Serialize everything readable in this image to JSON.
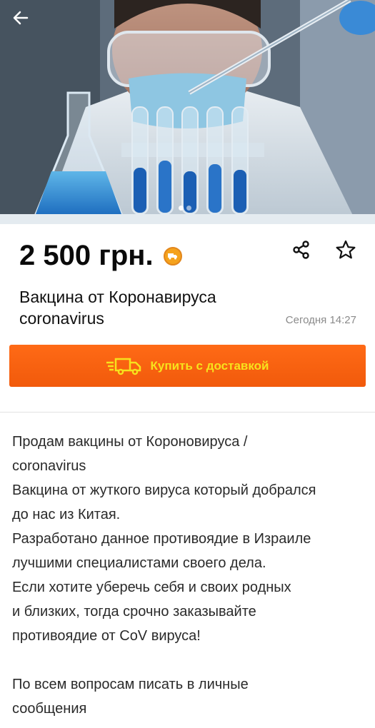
{
  "listing": {
    "price": "2 500 грн.",
    "title_line1": "Вакцина от Коронавируса",
    "title_line2": "coronavirus",
    "date": "Сегодня 14:27"
  },
  "actions": {
    "buy_label": "Купить с доставкой"
  },
  "icons": {
    "back": "arrow-left-icon",
    "share": "share-icon",
    "favorite": "star-outline-icon",
    "delivery": "delivery-truck-icon"
  },
  "colors": {
    "accent": "#f15a0b",
    "buy_text": "#f7e21c"
  },
  "gallery": {
    "current": 1,
    "total": 2
  },
  "description": {
    "lines": [
      "Продам вакцины от Короновируса /",
      "coronavirus",
      "Вакцина от жуткого вируса который добрался",
      "до нас из Китая.",
      "Разработано данное противоядие в Израиле",
      "лучшими специалистами своего дела.",
      "Если хотите уберечь себя и своих родных",
      "и близких, тогда срочно заказывайте",
      "противоядие от CoV вируса!"
    ],
    "lines2": [
      "По всем вопросам писать в личные",
      "сообщения"
    ]
  }
}
